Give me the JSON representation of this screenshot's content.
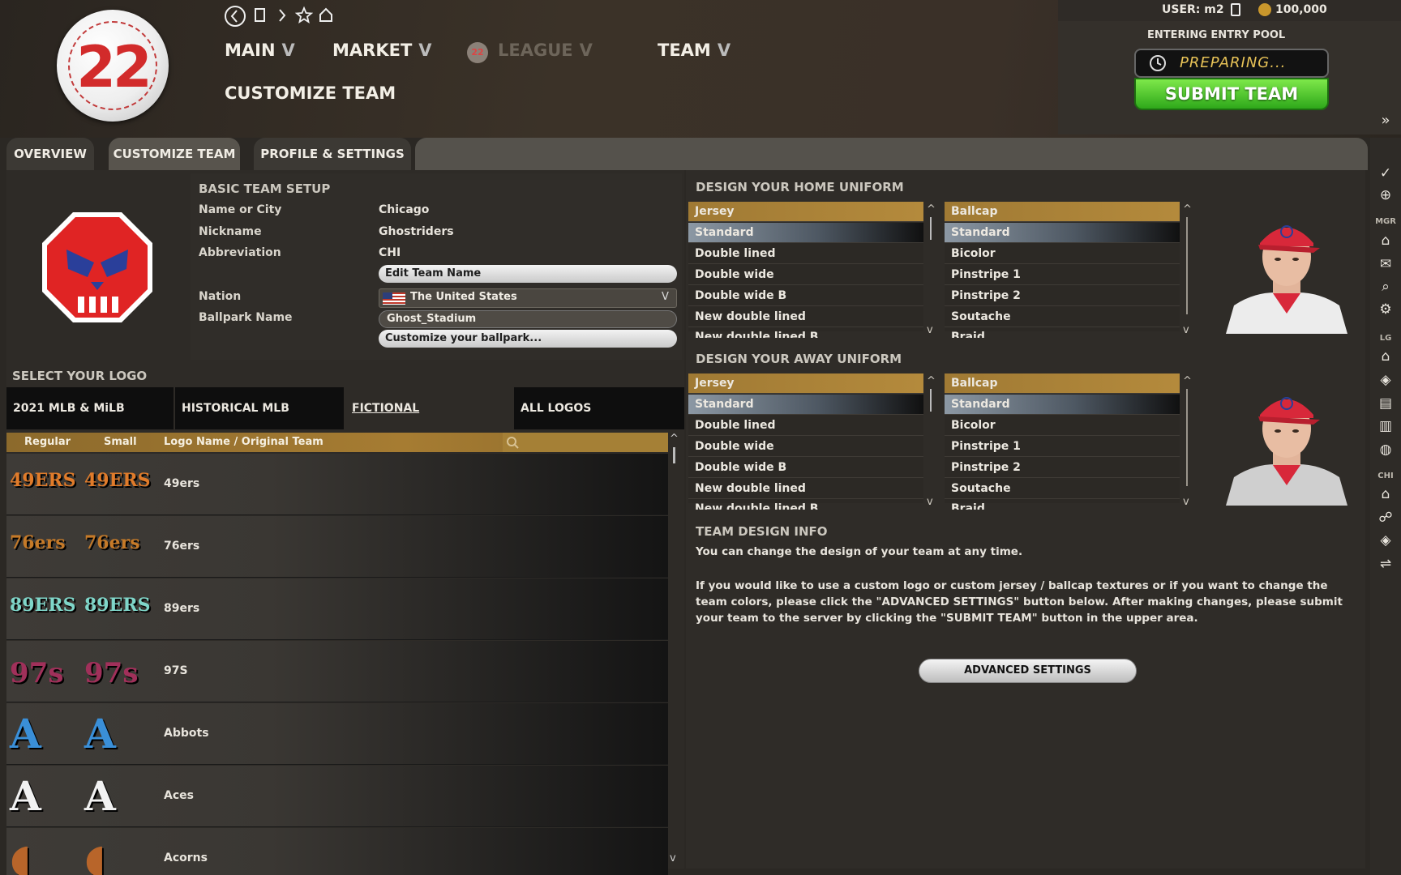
{
  "header": {
    "ball_number": "22",
    "nav": {
      "back": "⟨",
      "forward": "⟩",
      "bookmark_icon": "bookmark-icon",
      "star_icon": "star-icon",
      "home_icon": "home-icon"
    },
    "menus": [
      {
        "label": "MAIN"
      },
      {
        "label": "MARKET"
      },
      {
        "label": "LEAGUE",
        "disabled": true
      },
      {
        "label": "TEAM"
      }
    ],
    "chevron": "V",
    "page_title": "CUSTOMIZE TEAM",
    "league_badge": "22"
  },
  "user": {
    "label": "USER: m2",
    "coins": "100,000"
  },
  "entry": {
    "label": "ENTERING ENTRY POOL",
    "status": "PREPARING...",
    "submit_label": "SUBMIT TEAM"
  },
  "tabs": [
    {
      "label": "OVERVIEW"
    },
    {
      "label": "CUSTOMIZE TEAM",
      "active": true
    },
    {
      "label": "PROFILE & SETTINGS"
    }
  ],
  "setup": {
    "title": "BASIC TEAM SETUP",
    "fields": [
      {
        "label": "Name or City",
        "value": "Chicago"
      },
      {
        "label": "Nickname",
        "value": "Ghostriders"
      },
      {
        "label": "Abbreviation",
        "value": "CHI"
      }
    ],
    "edit_name_btn": "Edit Team Name",
    "nation_label": "Nation",
    "nation_value": "The United States",
    "ballpark_label": "Ballpark Name",
    "ballpark_value": "Ghost_Stadium",
    "customize_ballpark_btn": "Customize your ballpark..."
  },
  "logos": {
    "title": "SELECT YOUR LOGO",
    "tabs": [
      "2021 MLB & MiLB",
      "HISTORICAL MLB",
      "FICTIONAL",
      "ALL LOGOS"
    ],
    "active_tab": "FICTIONAL",
    "columns": [
      "Regular",
      "Small",
      "Logo Name / Original Team"
    ],
    "rows": [
      {
        "name": "49ers",
        "glyph": "49ERS",
        "color": "#e07b2a"
      },
      {
        "name": "76ers",
        "glyph": "76ers",
        "color": "#c67a28"
      },
      {
        "name": "89ers",
        "glyph": "89ERS",
        "color": "#7fd6c9"
      },
      {
        "name": "97S",
        "glyph": "97s",
        "color": "#a0305a"
      },
      {
        "name": "Abbots",
        "glyph": "A",
        "color": "#3a8fd8"
      },
      {
        "name": "Aces",
        "glyph": "A",
        "color": "#f2f2f2"
      },
      {
        "name": "Acorns",
        "glyph": "◖",
        "color": "#b8652a"
      }
    ]
  },
  "home_uniform": {
    "title": "DESIGN YOUR HOME UNIFORM",
    "jersey": {
      "header": "Jersey",
      "selected": "Standard",
      "items": [
        "Double lined",
        "Double wide",
        "Double wide B",
        "New double lined"
      ],
      "cut": "New double lined B"
    },
    "ballcap": {
      "header": "Ballcap",
      "selected": "Standard",
      "items": [
        "Bicolor",
        "Pinstripe 1",
        "Pinstripe 2",
        "Soutache"
      ],
      "cut": "Braid"
    }
  },
  "away_uniform": {
    "title": "DESIGN YOUR AWAY UNIFORM",
    "jersey": {
      "header": "Jersey",
      "selected": "Standard",
      "items": [
        "Double lined",
        "Double wide",
        "Double wide B",
        "New double lined"
      ],
      "cut": "New double lined B"
    },
    "ballcap": {
      "header": "Ballcap",
      "selected": "Standard",
      "items": [
        "Bicolor",
        "Pinstripe 1",
        "Pinstripe 2",
        "Soutache"
      ],
      "cut": "Braid"
    }
  },
  "info": {
    "title": "TEAM DESIGN INFO",
    "line1": "You can change the design of your team at any time.",
    "line2": "If you would like to use a custom logo or custom jersey / ballcap textures or if you want to change the team colors, please click the \"ADVANCED SETTINGS\" button below. After making changes, please submit your team to the server by clicking the \"SUBMIT TEAM\" button in the upper area.",
    "advanced_btn": "ADVANCED SETTINGS"
  },
  "sidebar": {
    "collapse": "»",
    "mgr_label": "MGR",
    "lg_label": "LG",
    "chi_label": "CHI"
  },
  "colors": {
    "accent_gold": "#a67c32",
    "submit_green": "#3cc21f",
    "logo_red": "#e02424",
    "logo_blue": "#2a3f9a"
  }
}
